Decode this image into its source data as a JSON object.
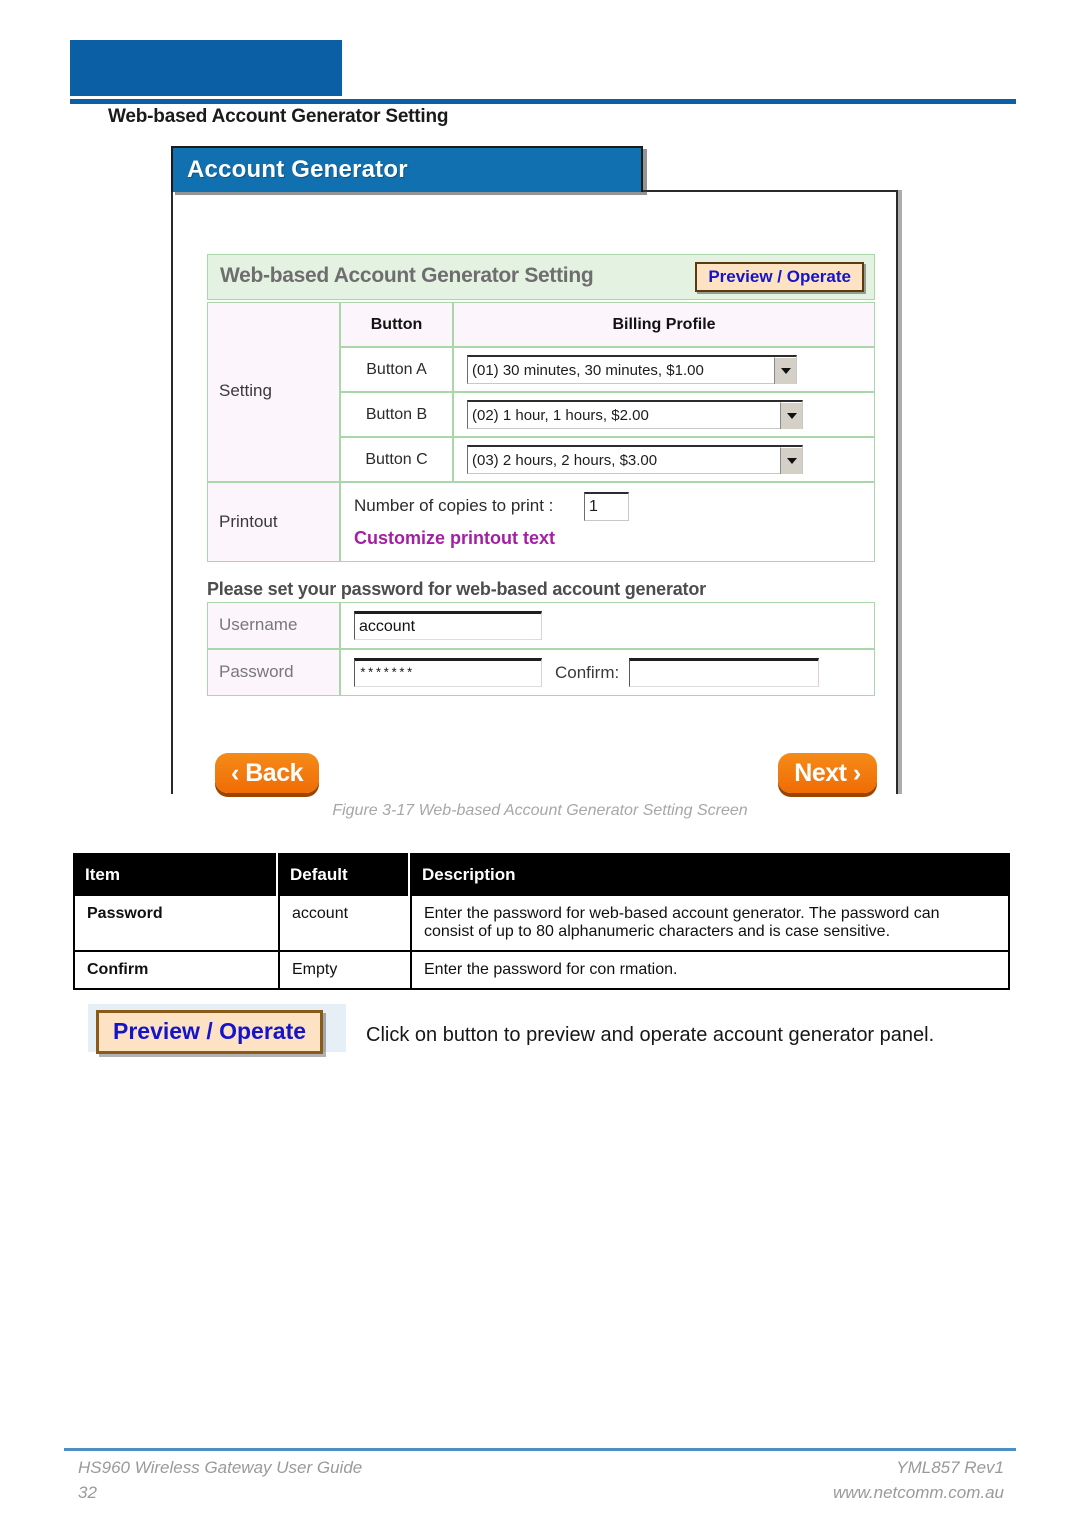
{
  "page": {
    "section_title": "Web-based Account Generator Setting",
    "accent_blue": "#0a5fa5"
  },
  "screenshot": {
    "window_title": "Account Generator",
    "section_heading": "Web-based Account Generator Setting",
    "preview_operate_label": "Preview / Operate",
    "setting": {
      "row_label": "Setting",
      "col_button": "Button",
      "col_profile": "Billing Profile",
      "rows": [
        {
          "button": "Button A",
          "profile": "(01) 30 minutes, 30 minutes, $1.00"
        },
        {
          "button": "Button B",
          "profile": "(02) 1 hour, 1 hours, $2.00"
        },
        {
          "button": "Button C",
          "profile": "(03) 2 hours, 2 hours, $3.00"
        }
      ]
    },
    "printout": {
      "row_label": "Printout",
      "copies_label": "Number of copies to print :",
      "copies_value": "1",
      "customize_link": "Customize printout text",
      "link_color": "#a31fa3"
    },
    "password_section": {
      "heading": "Please set your password for web-based account generator",
      "username_label": "Username",
      "username_value": "account",
      "password_label": "Password",
      "password_value": "*******",
      "confirm_label": "Confirm:",
      "confirm_value": ""
    },
    "nav": {
      "back_label": "‹ Back",
      "next_label": "Next ›",
      "button_color": "#ef6c05"
    }
  },
  "figure_caption": "Figure 3-17 Web-based Account Generator Setting Screen",
  "description_table": {
    "headers": [
      "Item",
      "Default",
      "Description"
    ],
    "rows": [
      {
        "item": "Password",
        "default": "account",
        "description_line1": "Enter the password for web-based account generator. The password can",
        "description_line2": "consist of up to 80 alphanumeric characters and is case sensitive."
      },
      {
        "item": "Confirm",
        "default": "Empty",
        "description_line1": "Enter the password for con rmation.",
        "description_line2": ""
      }
    ]
  },
  "preview_operate_note": {
    "button_label": "Preview / Operate",
    "text": "Click on button to preview and operate account generator panel."
  },
  "footer": {
    "left_top": "HS960 Wireless Gateway User Guide",
    "left_bottom": "32",
    "right_top": "YML857 Rev1",
    "right_bottom": "www.netcomm.com.au"
  }
}
